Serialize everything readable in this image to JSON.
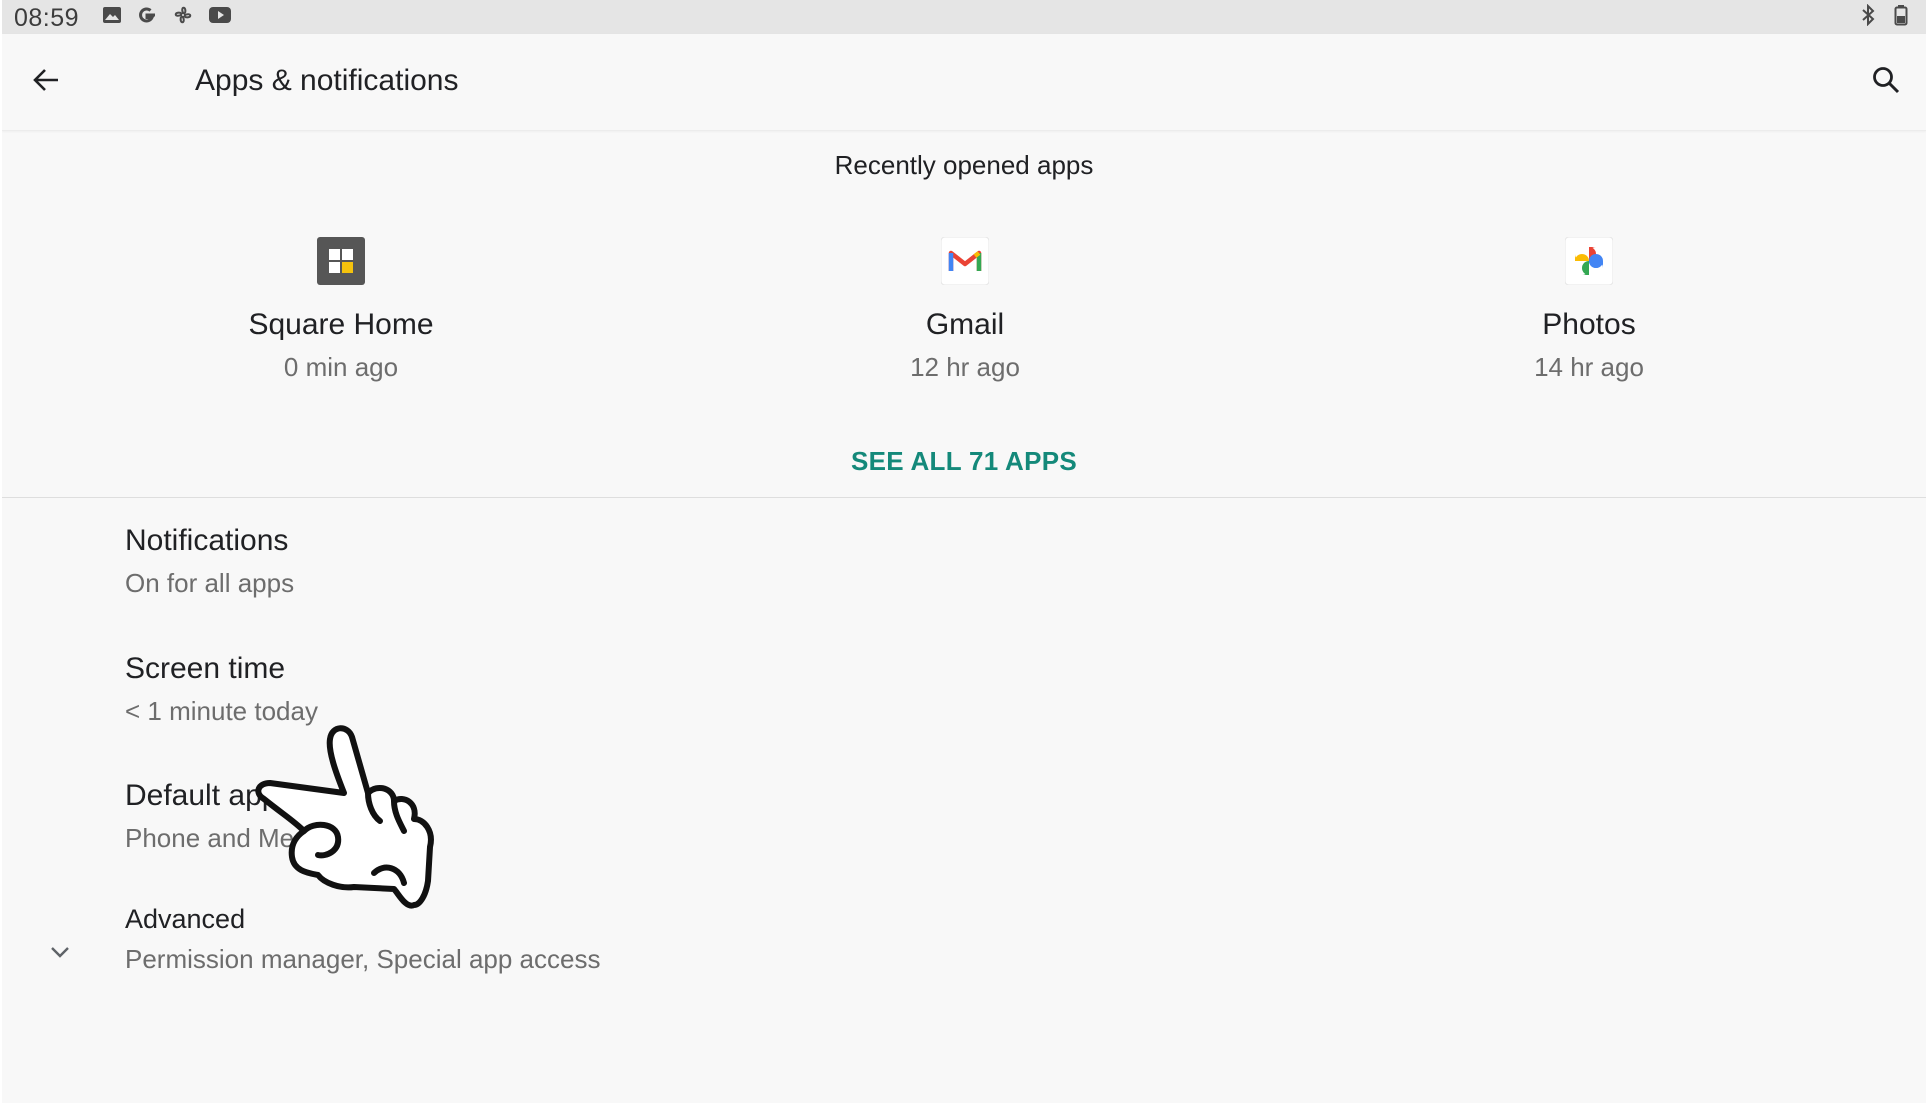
{
  "status_bar": {
    "time": "08:59",
    "left_icons": [
      "image-icon",
      "google-g-icon",
      "fan-icon",
      "youtube-icon"
    ],
    "right_icons": [
      "bluetooth-icon",
      "battery-icon"
    ]
  },
  "toolbar": {
    "title": "Apps & notifications",
    "back_icon": "arrow-back-icon",
    "search_icon": "search-icon"
  },
  "recent": {
    "header": "Recently opened apps",
    "apps": [
      {
        "name": "Square Home",
        "time": "0 min ago",
        "icon": "square-home-icon"
      },
      {
        "name": "Gmail",
        "time": "12 hr ago",
        "icon": "gmail-icon"
      },
      {
        "name": "Photos",
        "time": "14 hr ago",
        "icon": "photos-icon"
      }
    ],
    "see_all": "SEE ALL 71 APPS"
  },
  "settings": [
    {
      "title": "Notifications",
      "subtitle": "On for all apps"
    },
    {
      "title": "Screen time",
      "subtitle": "< 1 minute today"
    },
    {
      "title": "Default apps",
      "subtitle": "Phone and Messages"
    },
    {
      "title": "Advanced",
      "subtitle": "Permission manager, Special app access",
      "icon": "chevron-down-icon"
    }
  ],
  "colors": {
    "accent": "#14897a",
    "background": "#f8f8f8",
    "status_bar": "#e5e5e5",
    "primary_text": "#202124",
    "secondary_text": "#6d6d6d"
  }
}
